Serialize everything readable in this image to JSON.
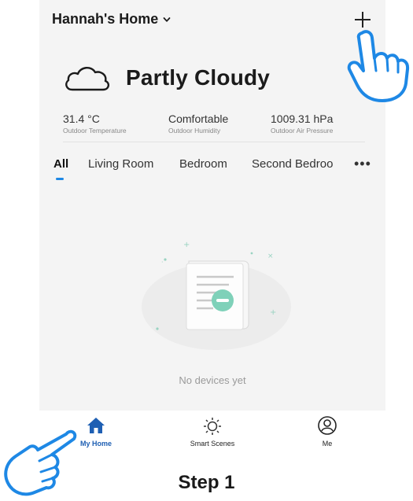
{
  "header": {
    "home_name": "Hannah's Home"
  },
  "weather": {
    "condition": "Partly Cloudy",
    "stats": [
      {
        "value": "31.4 °C",
        "label": "Outdoor Temperature"
      },
      {
        "value": "Comfortable",
        "label": "Outdoor Humidity"
      },
      {
        "value": "1009.31 hPa",
        "label": "Outdoor Air Pressure"
      }
    ]
  },
  "tabs": [
    "All",
    "Living Room",
    "Bedroom",
    "Second Bedroo"
  ],
  "empty": {
    "message": "No devices yet"
  },
  "tabbar": [
    {
      "label": "My Home",
      "icon": "home-icon",
      "active": true
    },
    {
      "label": "Smart Scenes",
      "icon": "sun-icon",
      "active": false
    },
    {
      "label": "Me",
      "icon": "user-icon",
      "active": false
    }
  ],
  "caption": "Step 1",
  "colors": {
    "accent": "#1e88e5",
    "tab_active": "#1e5fb3",
    "hand_outline": "#1e88e5",
    "art_green": "#7fd1b9"
  }
}
